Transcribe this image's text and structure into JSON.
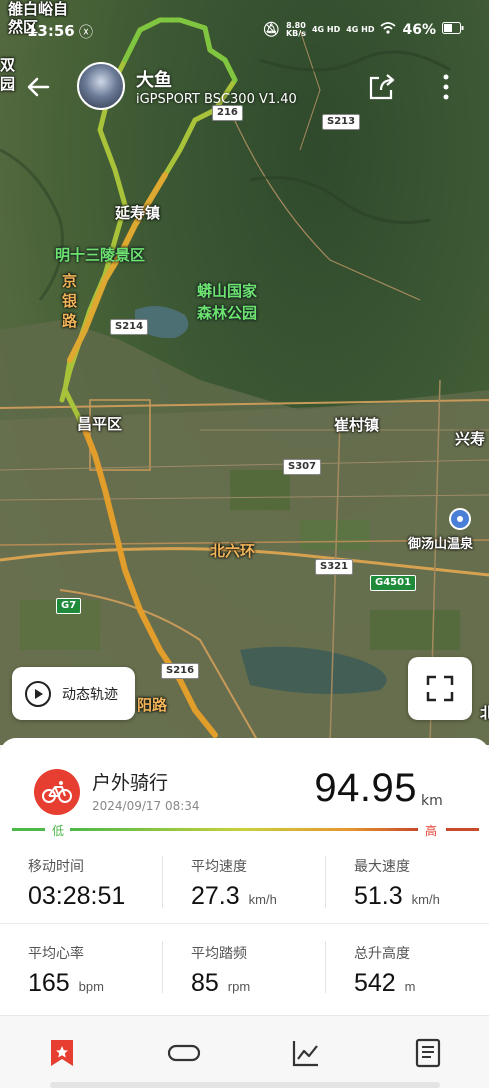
{
  "status_bar": {
    "time": "13:56",
    "speed": "8.80",
    "speed_unit": "KB/s",
    "net1": "4G HD",
    "net2": "4G HD",
    "battery": "46%"
  },
  "header": {
    "user_name": "大鱼",
    "device": "iGPSPORT BSC300  V1.40"
  },
  "map": {
    "labels": {
      "top_left1": "雒白峪自",
      "top_left2": "然区",
      "top_left3": "双",
      "top_left4": "园",
      "yanshou": "延寿镇",
      "ming13": "明十三陵景区",
      "jingyin1": "京",
      "jingyin2": "银",
      "jingyin3": "路",
      "mangshan1": "蟒山国家",
      "mangshan2": "森林公园",
      "changping": "昌平区",
      "cuicun": "崔村镇",
      "xingshou": "兴寿",
      "beiliuhuan": "北六环",
      "yutang": "御汤山温泉",
      "yanglu": "阳路",
      "bei": "北"
    },
    "shields": {
      "s213": "S213",
      "s216_top": "216",
      "s214": "S214",
      "s307": "S307",
      "s321": "S321",
      "g4501": "G4501",
      "g7": "G7",
      "s216_bottom": "S216"
    },
    "track_button": "动态轨迹"
  },
  "summary": {
    "sport": "户外骑行",
    "datetime": "2024/09/17 08:34",
    "distance": "94.95",
    "distance_unit": "km",
    "legend_low": "低",
    "legend_high": "高"
  },
  "stats": [
    {
      "label": "移动时间",
      "value": "03:28:51",
      "unit": ""
    },
    {
      "label": "平均速度",
      "value": "27.3",
      "unit": "km/h"
    },
    {
      "label": "最大速度",
      "value": "51.3",
      "unit": "km/h"
    },
    {
      "label": "平均心率",
      "value": "165",
      "unit": "bpm"
    },
    {
      "label": "平均踏频",
      "value": "85",
      "unit": "rpm"
    },
    {
      "label": "总升高度",
      "value": "542",
      "unit": "m"
    }
  ],
  "tabs": [
    "bookmark-icon",
    "ring-icon",
    "chart-icon",
    "document-icon"
  ],
  "colors": {
    "accent_red": "#e63e30",
    "low_green": "#4cb848",
    "high_red": "#c84a2a"
  }
}
